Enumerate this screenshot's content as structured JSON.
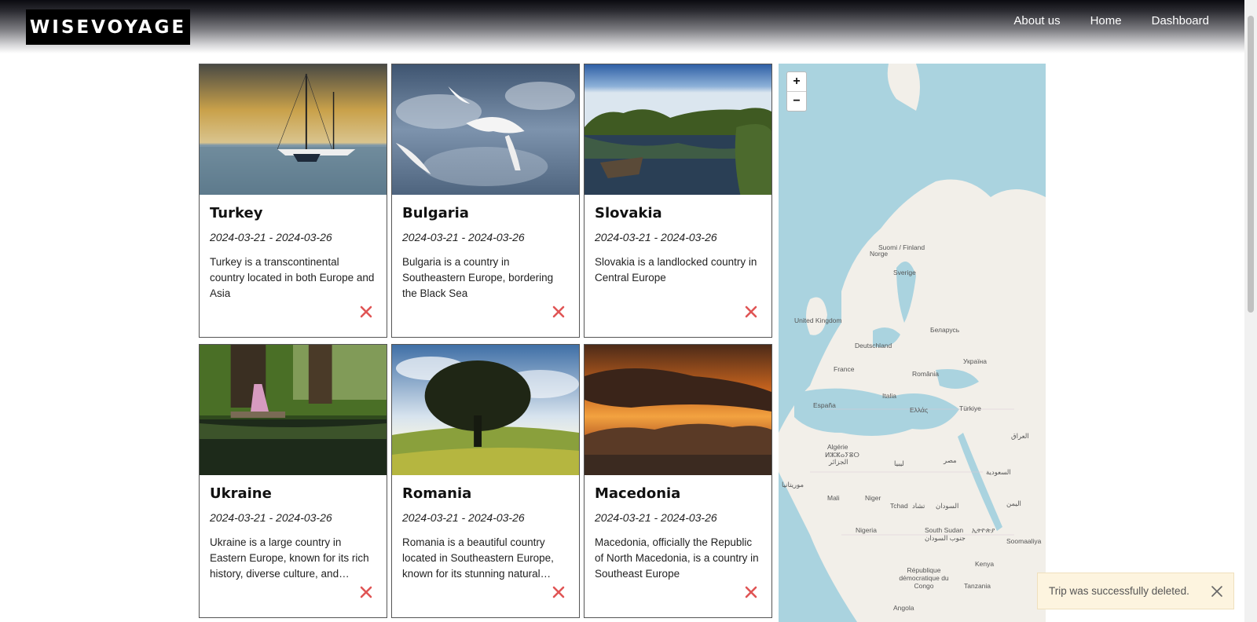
{
  "header": {
    "logo_text": "WISEVOYAGE",
    "nav": [
      {
        "label": "About us"
      },
      {
        "label": "Home"
      },
      {
        "label": "Dashboard"
      }
    ]
  },
  "trips": [
    {
      "title": "Turkey",
      "dates": "2024-03-21 - 2024-03-26",
      "description": "Turkey is a transcontinental country located in both Europe and Asia",
      "image": "sailboats-sunset"
    },
    {
      "title": "Bulgaria",
      "dates": "2024-03-21 - 2024-03-26",
      "description": "Bulgaria is a country in Southeastern Europe, bordering the Black Sea",
      "image": "seagulls-sky"
    },
    {
      "title": "Slovakia",
      "dates": "2024-03-21 - 2024-03-26",
      "description": "Slovakia is a landlocked country in Central Europe",
      "image": "lake-boat"
    },
    {
      "title": "Ukraine",
      "dates": "2024-03-21 - 2024-03-26",
      "description": "Ukraine is a large country in Eastern Europe, known for its rich history, diverse culture, and beautiful landscapes",
      "image": "forest-stream"
    },
    {
      "title": "Romania",
      "dates": "2024-03-21 - 2024-03-26",
      "description": "Romania is a beautiful country located in Southeastern Europe, known for its stunning natural landscapes, rich history",
      "image": "lone-tree"
    },
    {
      "title": "Macedonia",
      "dates": "2024-03-21 - 2024-03-26",
      "description": "Macedonia, officially the Republic of North Macedonia, is a country in Southeast Europe",
      "image": "sunset-mountains"
    }
  ],
  "map": {
    "zoom_in": "+",
    "zoom_out": "−",
    "labels": [
      "Suomi / Finland",
      "Norge",
      "Sverige",
      "United Kingdom",
      "Беларусь",
      "Deutschland",
      "Україна",
      "France",
      "România",
      "Italia",
      "España",
      "Ελλάς",
      "Türkiye",
      "العراق",
      "Algérie",
      "ⵍⵣⵣⴰⵢⴻⵔ",
      "الجزائر",
      "ليبيا",
      "مصر",
      "السعودية",
      "موريتانيا",
      "Mali",
      "Niger",
      "Tchad",
      "تشاد",
      "السودان",
      "اليمن",
      "Nigeria",
      "South Sudan",
      "جنوب السودان",
      "ኢትዮጵያ",
      "Soomaaliya",
      "Kenya",
      "République démocratique du Congo",
      "Tanzania",
      "Angola"
    ]
  },
  "toast": {
    "message": "Trip was successfully deleted."
  },
  "colors": {
    "delete": "#e05555",
    "toast_bg": "#fdf4df",
    "water": "#aad3df",
    "land": "#f2efe9"
  }
}
